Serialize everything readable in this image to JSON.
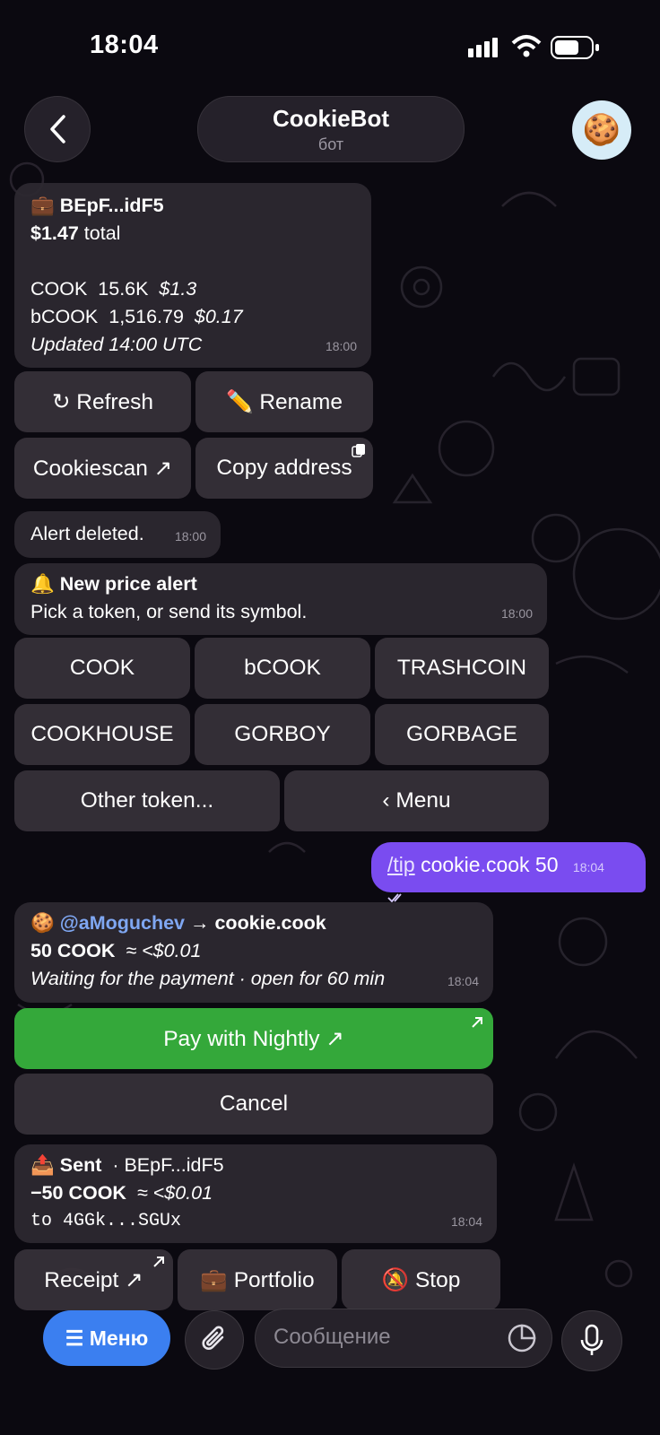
{
  "status_bar": {
    "time": "18:04"
  },
  "header": {
    "title": "CookieBot",
    "subtitle": "бот",
    "avatar_emoji": "🍪"
  },
  "wallet_card": {
    "line1_emoji": "💼",
    "line1": "BEpF...idF5",
    "line2_amount": "$1.47",
    "line2_suffix": "total",
    "rows": [
      {
        "token": "COOK",
        "amount": "15.6K",
        "value": "$1.3"
      },
      {
        "token": "bCOOK",
        "amount": "1,516.79",
        "value": "$0.17"
      }
    ],
    "updated": "Updated 14:00 UTC",
    "time": "18:00"
  },
  "wallet_buttons": {
    "refresh": "↻ Refresh",
    "rename": "✏️ Rename",
    "cookiescan": "Cookiescan ↗",
    "copy_address": "Copy address"
  },
  "alert_deleted": {
    "text": "Alert deleted.",
    "time": "18:00"
  },
  "price_alert": {
    "emoji": "🔔",
    "title": "New price alert",
    "body": "Pick a token, or send its symbol.",
    "time": "18:00"
  },
  "token_buttons": {
    "row1": [
      "COOK",
      "bCOOK",
      "TRASHCOIN"
    ],
    "row2": [
      "COOKHOUSE",
      "GORBOY",
      "GORBAGE"
    ],
    "other": "Other token...",
    "menu": "‹ Menu"
  },
  "outgoing": {
    "command": "/tip",
    "rest": "cookie.cook 50",
    "time": "18:04"
  },
  "tip_card": {
    "emoji": "🍪",
    "from": "@aMoguchev",
    "arrow_to": "→ cookie.cook",
    "amount": "50 COOK",
    "approx": "≈ <$0.01",
    "status": "Waiting for the payment · open for 60 min",
    "time": "18:04"
  },
  "tip_buttons": {
    "pay": "Pay with Nightly ↗",
    "cancel": "Cancel"
  },
  "sent_card": {
    "emoji": "📤",
    "label": "Sent",
    "wallet": "· BEpF...idF5",
    "amount": "−50 COOK",
    "approx": "≈ <$0.01",
    "to": "to 4GGk...SGUx",
    "time": "18:04"
  },
  "sent_buttons": {
    "receipt": "Receipt ↗",
    "portfolio": "💼 Portfolio",
    "stop": "🔕 Stop"
  },
  "bottom_bar": {
    "menu_label": "☰ Меню",
    "message_placeholder": "Сообщение"
  },
  "colors": {
    "accent_blue": "#3b7ff0",
    "outgoing_purple": "#7a4cf0",
    "pay_green": "#34a83a",
    "mention_blue": "#7fa7f2"
  }
}
